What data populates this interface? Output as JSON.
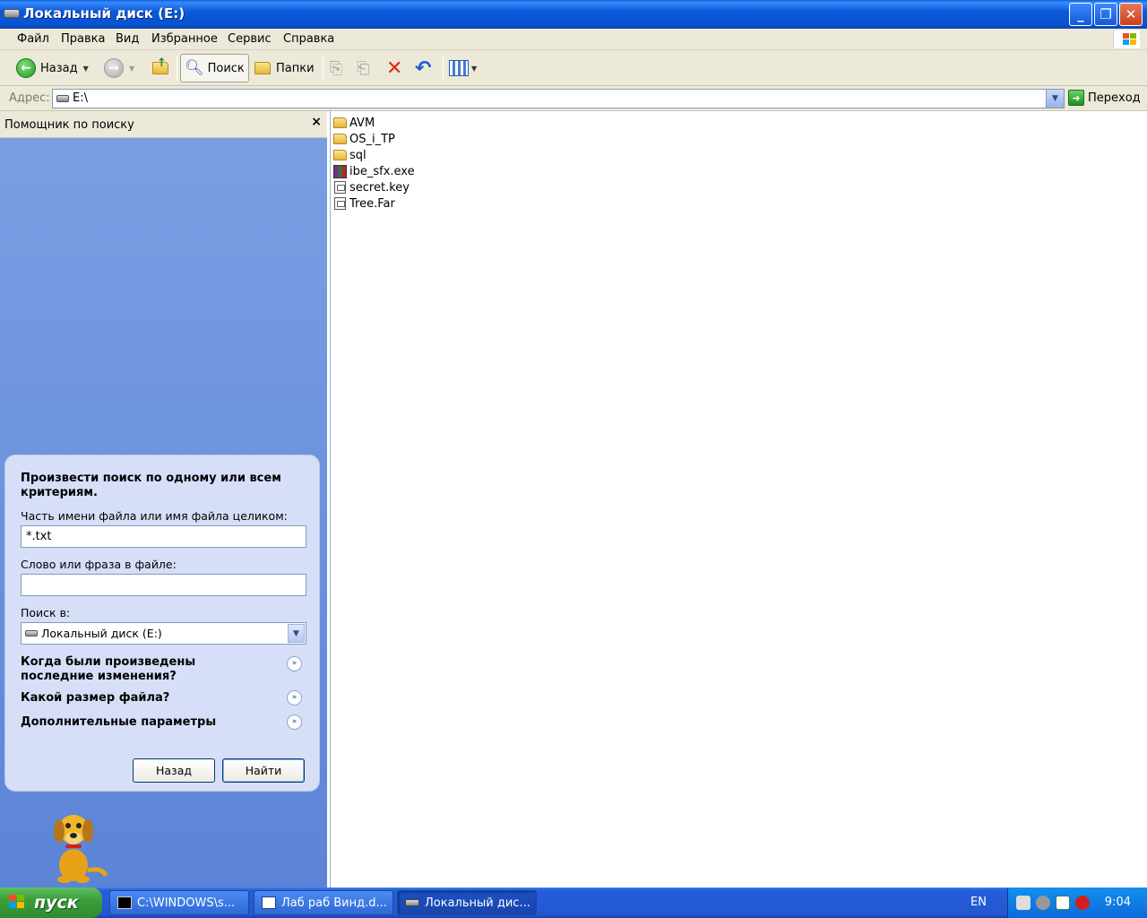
{
  "window": {
    "title": "Локальный диск (E:)"
  },
  "menu": [
    "Файл",
    "Правка",
    "Вид",
    "Избранное",
    "Сервис",
    "Справка"
  ],
  "toolbar": {
    "back_label": "Назад",
    "search_label": "Поиск",
    "folders_label": "Папки"
  },
  "address": {
    "label": "Адрес:",
    "value": "E:\\",
    "go_label": "Переход"
  },
  "search_pane": {
    "title": "Помощник по поиску",
    "close": "×",
    "heading": "Произвести поиск по одному или всем критериям.",
    "filename_label": "Часть имени файла или имя файла целиком:",
    "filename_value": "*.txt",
    "phrase_label": "Слово или фраза в файле:",
    "phrase_value": "",
    "look_in_label": "Поиск в:",
    "look_in_value": "Локальный диск (E:)",
    "option_modified": "Когда были произведены последние изменения?",
    "option_size": "Какой размер файла?",
    "option_advanced": "Дополнительные параметры",
    "back_button": "Назад",
    "search_button": "Найти"
  },
  "files": [
    {
      "name": "AVM",
      "type": "folder"
    },
    {
      "name": "OS_i_TP",
      "type": "folder"
    },
    {
      "name": "sql",
      "type": "folder"
    },
    {
      "name": "ibe_sfx.exe",
      "type": "exe"
    },
    {
      "name": "secret.key",
      "type": "file"
    },
    {
      "name": "Tree.Far",
      "type": "file"
    }
  ],
  "taskbar": {
    "start_label": "пуск",
    "tasks": [
      {
        "label": "C:\\WINDOWS\\s...",
        "active": false
      },
      {
        "label": "Лаб раб Винд.d...",
        "active": false
      },
      {
        "label": "Локальный дис...",
        "active": true
      }
    ],
    "language": "EN",
    "clock": "9:04"
  },
  "colors": {
    "titlebar": "#0c59d8",
    "pane_bg": "#6d93de",
    "card_bg": "#d6dff7",
    "taskbar": "#245edb",
    "start": "#3a9f3a"
  }
}
